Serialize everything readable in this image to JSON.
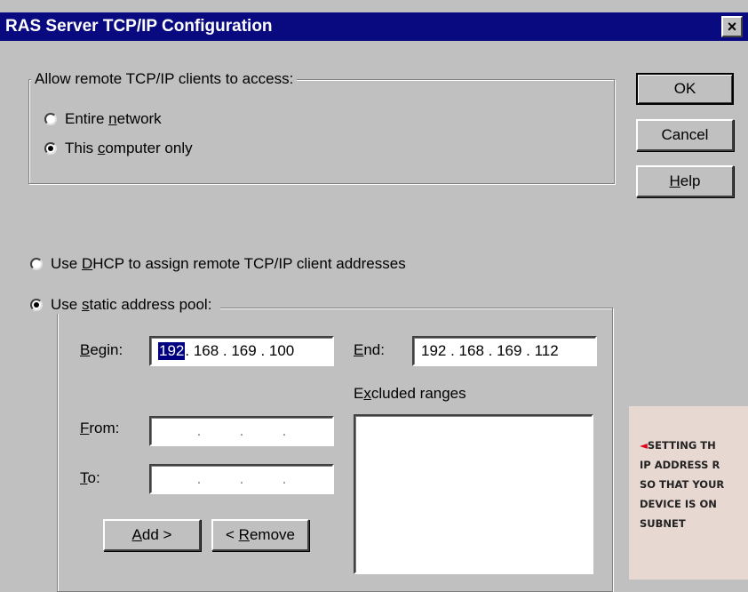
{
  "window": {
    "title": "RAS Server TCP/IP Configuration",
    "close_label": "×"
  },
  "access_group": {
    "legend": "Allow remote TCP/IP clients to access:",
    "options": [
      {
        "pre": "Entire ",
        "ul": "n",
        "post": "etwork",
        "checked": false
      },
      {
        "pre": "This ",
        "ul": "c",
        "post": "omputer only",
        "checked": true
      }
    ]
  },
  "buttons": {
    "ok": "OK",
    "cancel": "Cancel",
    "help": {
      "pre": "",
      "ul": "H",
      "post": "elp"
    }
  },
  "dhcp_option": {
    "pre": "Use ",
    "ul": "D",
    "post": "HCP to assign remote TCP/IP client addresses",
    "checked": false
  },
  "static_option": {
    "pre": "Use ",
    "ul": "s",
    "post": "tatic address pool:",
    "checked": true
  },
  "pool": {
    "begin_label": {
      "pre": "",
      "ul": "B",
      "post": "egin:"
    },
    "begin_value": {
      "selected": "192",
      "rest": " . 168 . 169 . 100"
    },
    "end_label": {
      "pre": "",
      "ul": "E",
      "post": "nd:"
    },
    "end_value": "192 . 168 . 169 . 112",
    "excluded_label": {
      "pre": "E",
      "ul": "x",
      "post": "cluded ranges"
    },
    "from_label": {
      "pre": "",
      "ul": "F",
      "post": "rom:"
    },
    "to_label": {
      "pre": "",
      "ul": "T",
      "post": "o:"
    },
    "empty_dot": ".",
    "add_button": {
      "pre": "",
      "ul": "A",
      "post": "dd >"
    },
    "remove_button": {
      "pre": "< ",
      "ul": "R",
      "post": "emove"
    }
  },
  "caption": {
    "arrow": "◄",
    "lines": [
      "SETTING TH",
      "IP ADDRESS R",
      "SO THAT YOUR",
      "DEVICE IS ON",
      "SUBNET"
    ]
  }
}
